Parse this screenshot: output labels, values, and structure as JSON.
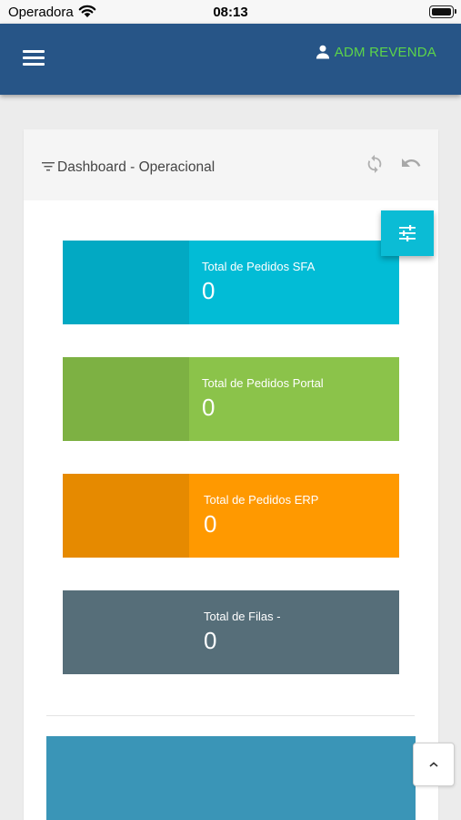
{
  "status_bar": {
    "carrier": "Operadora",
    "time": "08:13"
  },
  "header": {
    "menu_icon": "hamburger-icon",
    "user_icon": "person-icon",
    "user_name": "ADM REVENDA",
    "user_color": "#5cd44a",
    "background": "#275587"
  },
  "dashboard": {
    "title": "Dashboard - Operacional",
    "title_icon": "filter-icon",
    "actions": [
      {
        "icon": "refresh-icon"
      },
      {
        "icon": "undo-icon"
      }
    ],
    "filter_button_icon": "sliders-icon",
    "stats": [
      {
        "label": "Total de Pedidos SFA",
        "value": "0",
        "color_dark": "#02a9c3",
        "color_light": "#02bcd6"
      },
      {
        "label": "Total de Pedidos Portal",
        "value": "0",
        "color_dark": "#7db143",
        "color_light": "#8bc34a"
      },
      {
        "label": "Total de Pedidos ERP",
        "value": "0",
        "color_dark": "#e68a00",
        "color_light": "#ff9900"
      },
      {
        "label": "Total de Filas -",
        "value": "0",
        "color_dark": "#566e79",
        "color_light": "#566e79"
      }
    ]
  },
  "scroll_top_icon": "chevron-up-icon"
}
